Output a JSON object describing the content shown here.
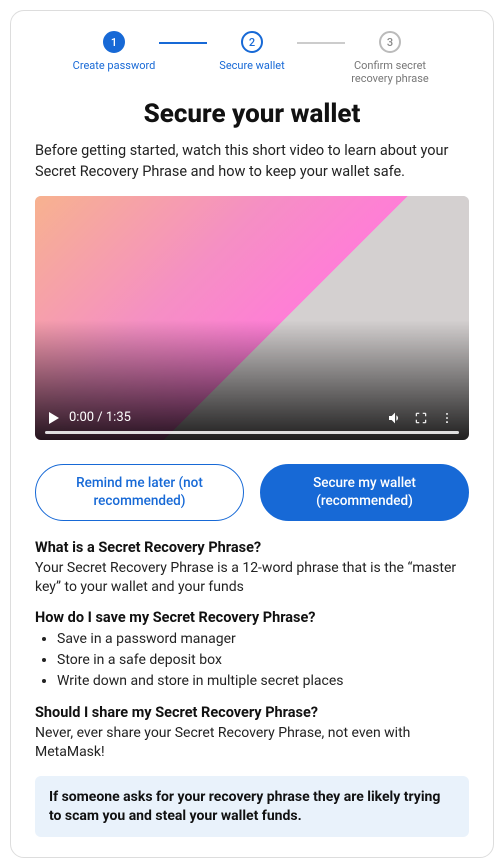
{
  "stepper": {
    "steps": [
      {
        "num": "1",
        "label": "Create password"
      },
      {
        "num": "2",
        "label": "Secure wallet"
      },
      {
        "num": "3",
        "label": "Confirm secret recovery phrase"
      }
    ]
  },
  "title": "Secure your wallet",
  "intro": "Before getting started, watch this short video to learn about your Secret Recovery Phrase and how to keep your wallet safe.",
  "video": {
    "time": "0:00 / 1:35"
  },
  "buttons": {
    "remind": "Remind me later (not recommended)",
    "secure": "Secure my wallet (recommended)"
  },
  "faq": {
    "q1": "What is a Secret Recovery Phrase?",
    "a1": "Your Secret Recovery Phrase is a 12-word phrase that is the “master key” to your wallet and your funds",
    "q2": "How do I save my Secret Recovery Phrase?",
    "a2_items": [
      "Save in a password manager",
      "Store in a safe deposit box",
      "Write down and store in multiple secret places"
    ],
    "q3": "Should I share my Secret Recovery Phrase?",
    "a3": "Never, ever share your Secret Recovery Phrase, not even with MetaMask!"
  },
  "warning": "If someone asks for your recovery phrase they are likely trying to scam you and steal your wallet funds."
}
